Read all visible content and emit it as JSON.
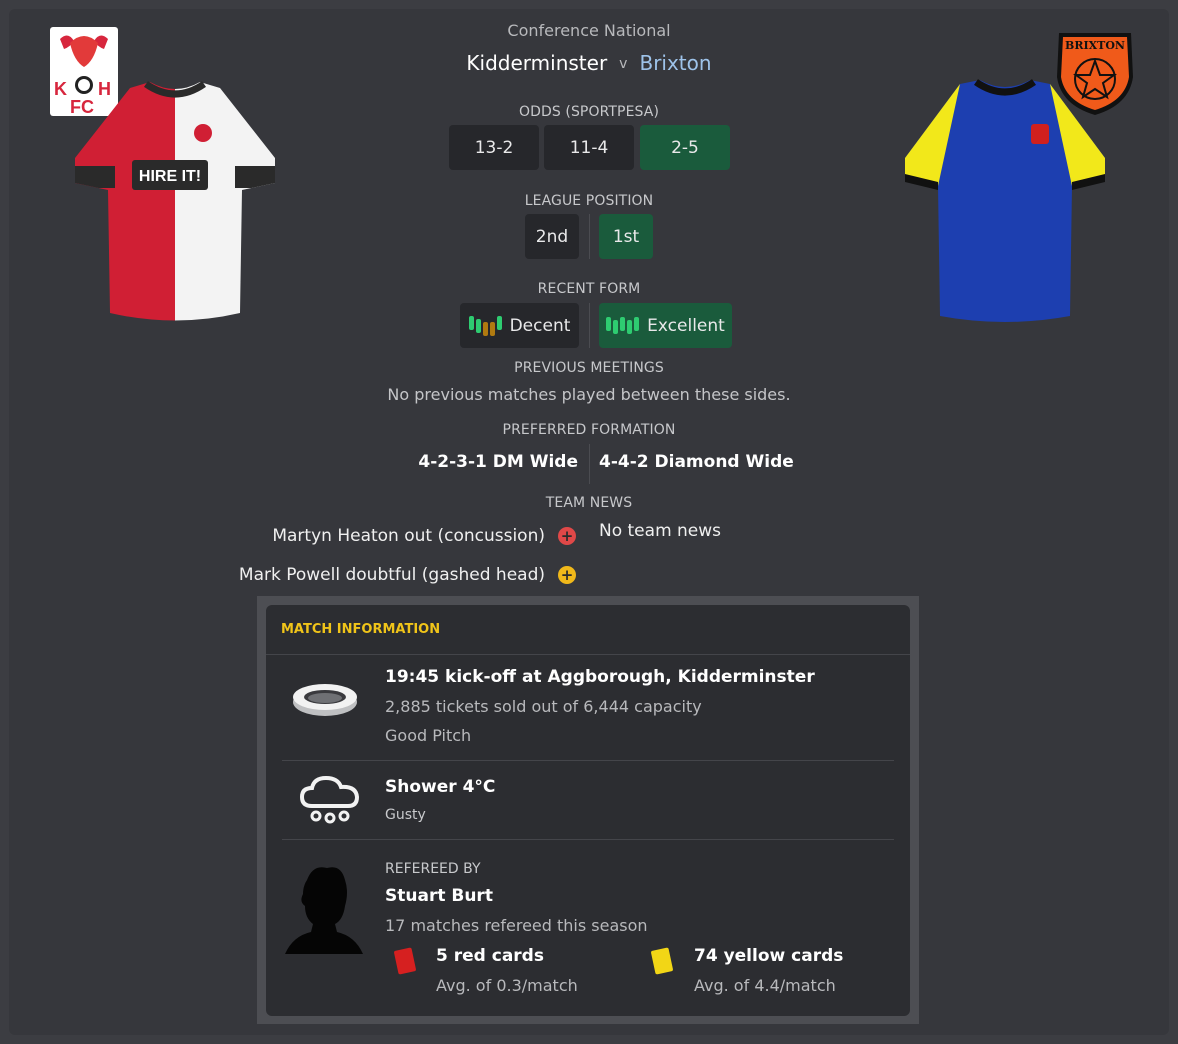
{
  "competition": "Conference National",
  "home": {
    "name": "Kidderminster",
    "badge_icon": "kidderminster-badge-icon",
    "kit_icon": "kidderminster-shirt-icon",
    "badge_text": "K H FC",
    "kit_sponsor": "HIRE IT!"
  },
  "vs_label": "v",
  "away": {
    "name": "Brixton",
    "badge_icon": "brixton-badge-icon",
    "kit_icon": "brixton-shirt-icon",
    "badge_text": "BRIXTON"
  },
  "odds": {
    "label": "ODDS (SPORTPESA)",
    "home": "13-2",
    "draw": "11-4",
    "away": "2-5"
  },
  "league_position": {
    "label": "LEAGUE POSITION",
    "home": "2nd",
    "away": "1st"
  },
  "recent_form": {
    "label": "RECENT FORM",
    "home": "Decent",
    "away": "Excellent",
    "home_bars": [
      "#2ecc71",
      "#2ecc71",
      "#b07a10",
      "#b07a10",
      "#2ecc71"
    ],
    "away_bars": [
      "#2ecc71",
      "#2ecc71",
      "#2ecc71",
      "#2ecc71",
      "#2ecc71"
    ]
  },
  "previous_meetings": {
    "label": "PREVIOUS MEETINGS",
    "text": "No previous matches played between these sides."
  },
  "preferred_formation": {
    "label": "PREFERRED FORMATION",
    "home": "4-2-3-1 DM Wide",
    "away": "4-4-2 Diamond Wide"
  },
  "team_news": {
    "label": "TEAM NEWS",
    "home": [
      {
        "text": "Martyn Heaton out (concussion)",
        "icon": "injury-red-icon",
        "color": "#e04848"
      },
      {
        "text": "Mark Powell doubtful (gashed head)",
        "icon": "injury-yellow-icon",
        "color": "#f0b81a"
      }
    ],
    "away": "No team news"
  },
  "match_info": {
    "header": "MATCH INFORMATION",
    "venue": {
      "icon": "stadium-icon",
      "title": "19:45 kick-off at Aggborough, Kidderminster",
      "tickets": "2,885 tickets sold out of 6,444 capacity",
      "pitch": "Good Pitch"
    },
    "weather": {
      "icon": "rain-cloud-icon",
      "title": "Shower 4°C",
      "wind": "Gusty"
    },
    "referee": {
      "icon": "referee-silhouette-icon",
      "label": "REFEREED BY",
      "name": "Stuart Burt",
      "matches": "17 matches refereed this season",
      "red_cards": "5 red cards",
      "red_avg": "Avg. of 0.3/match",
      "yellow_cards": "74 yellow cards",
      "yellow_avg": "Avg. of 4.4/match"
    }
  },
  "colors": {
    "accent_green": "#1a5b3c",
    "accent_yellow": "#f0c419",
    "away_name": "#9ec3ea"
  }
}
